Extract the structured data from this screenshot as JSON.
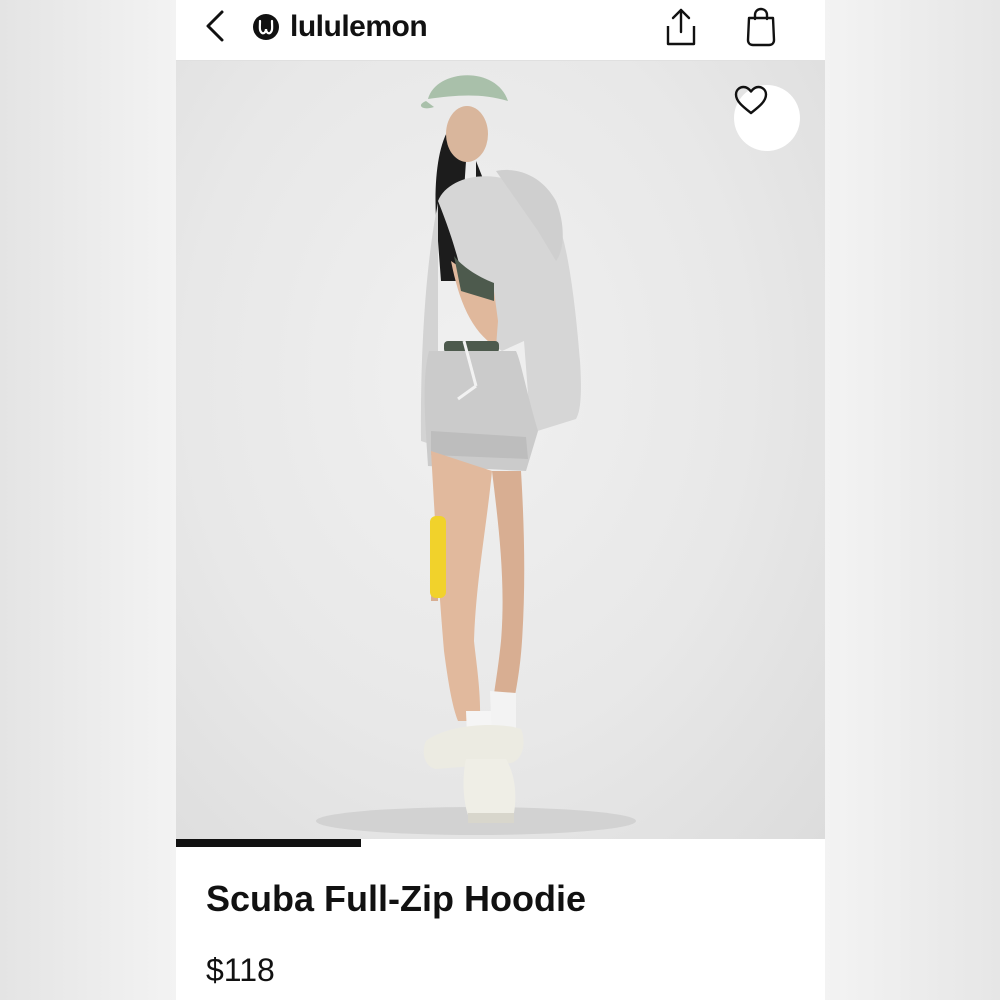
{
  "header": {
    "brand": "lululemon",
    "icons": [
      "back-chevron-icon",
      "lululemon-logo-icon",
      "share-icon",
      "shopping-bag-icon"
    ]
  },
  "gallery": {
    "image_subject": "model-in-grey-hoodie-and-shorts",
    "favorite_icon": "heart-icon",
    "progress": 0.285
  },
  "product": {
    "name": "Scuba Full-Zip Hoodie",
    "price": "$118"
  },
  "colors": {
    "text": "#111111",
    "progress": "#111111",
    "background": "#ffffff"
  }
}
